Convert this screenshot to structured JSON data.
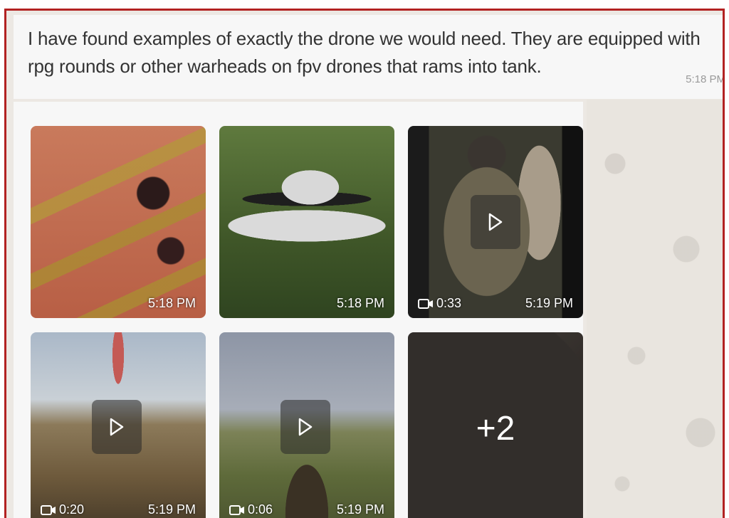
{
  "message": {
    "text": "I have found examples of exactly the drone we would need. They are equipped with rpg rounds or other warheads on fpv drones that rams into tank.",
    "time": "5:18 PM"
  },
  "album": {
    "tiles": [
      {
        "type": "image",
        "timestamp": "5:18 PM"
      },
      {
        "type": "image",
        "timestamp": "5:18 PM"
      },
      {
        "type": "video",
        "duration": "0:33",
        "timestamp": "5:19 PM"
      },
      {
        "type": "video",
        "duration": "0:20",
        "timestamp": "5:19 PM"
      },
      {
        "type": "video",
        "duration": "0:06",
        "timestamp": "5:19 PM"
      },
      {
        "type": "more",
        "more_count": "+2"
      }
    ]
  },
  "icons": {
    "play": "play-icon",
    "video_duration": "video-camera-icon"
  },
  "colors": {
    "frame_border": "#b22222",
    "bubble_bg": "#f7f7f7",
    "text": "#333333",
    "timestamp_muted": "#9a9a9a"
  }
}
